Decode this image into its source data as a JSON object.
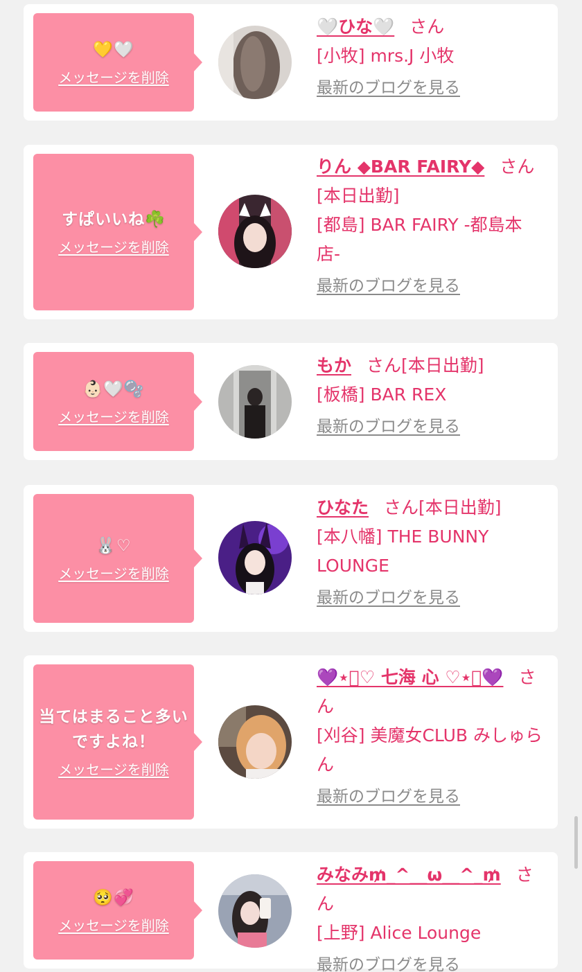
{
  "colors": {
    "page_bg": "#f1f1f1",
    "card_bg": "#ffffff",
    "bubble_bg": "#fc8fa5",
    "name_color": "#e4346a",
    "link_gray": "#8a8a8a"
  },
  "common": {
    "san_label": "さん",
    "delete_label": "メッセージを削除",
    "blog_label": "最新のブログを見る"
  },
  "items": [
    {
      "message": "💛🤍",
      "name": "🤍ひな🤍",
      "status": "",
      "shop_lines": [
        "[小牧] mrs.J 小牧"
      ],
      "avatar_icon": "avatar-photo-hair"
    },
    {
      "message": "すぱいいね☘️",
      "name": "りん ◆BAR FAIRY◆",
      "status": "",
      "shop_lines": [
        "[本日出勤]",
        "[都島] BAR FAIRY -都島本店-"
      ],
      "avatar_icon": "avatar-photo-cat-ears"
    },
    {
      "message": "👶🏻🤍🫧",
      "name": "もか",
      "status": "[本日出勤]",
      "shop_lines": [
        "[板橋] BAR REX"
      ],
      "avatar_icon": "avatar-photo-mirror"
    },
    {
      "message": "🐰♡",
      "name": "ひなた",
      "status": "[本日出勤]",
      "shop_lines": [
        "[本八幡] THE BUNNY LOUNGE"
      ],
      "avatar_icon": "avatar-photo-bunny"
    },
    {
      "message": "当てはまること多いですよね！",
      "name": "💜⋆͛♡ 七海 心 ♡⋆͛💜",
      "status": "",
      "shop_lines": [
        "[刈谷] 美魔女CLUB みしゅらん"
      ],
      "avatar_icon": "avatar-photo-selfie"
    },
    {
      "message": "🥺💞",
      "name": "みなみ₥_^__ω__^_₥",
      "status": "",
      "shop_lines": [
        "[上野] Alice Lounge"
      ],
      "avatar_icon": "avatar-photo-phone"
    }
  ]
}
